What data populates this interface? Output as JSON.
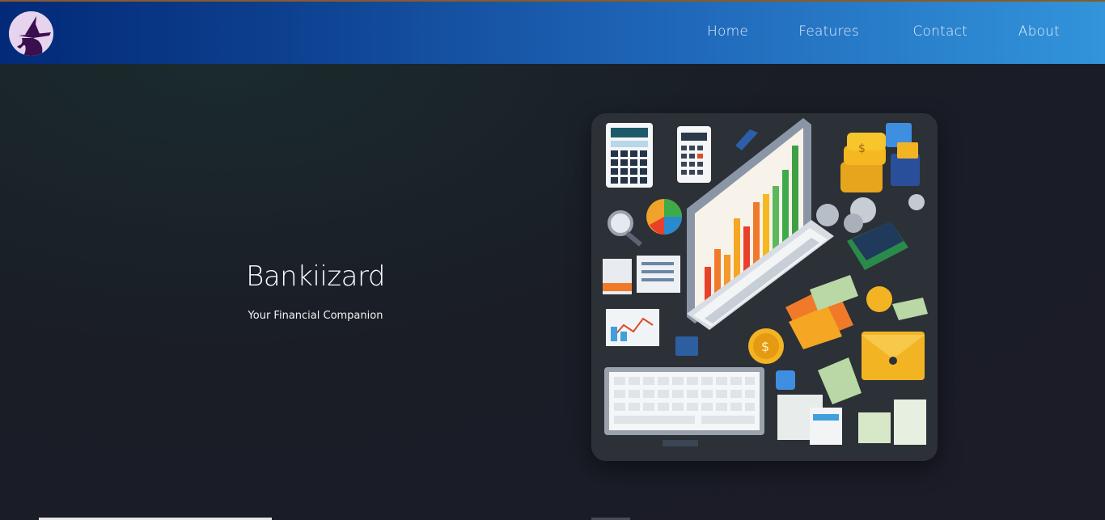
{
  "brand": {
    "logo_icon": "witch-silhouette-icon"
  },
  "nav": {
    "items": [
      {
        "label": "Home"
      },
      {
        "label": "Features"
      },
      {
        "label": "Contact"
      },
      {
        "label": "About"
      }
    ]
  },
  "hero": {
    "title": "Bankiizard",
    "subtitle": "Your Financial Companion",
    "illustration": "finance-desk-illustration"
  },
  "colors": {
    "header_start": "#022a78",
    "header_end": "#3294da",
    "background": "#1b1c28",
    "card_background": "#2c3037"
  }
}
